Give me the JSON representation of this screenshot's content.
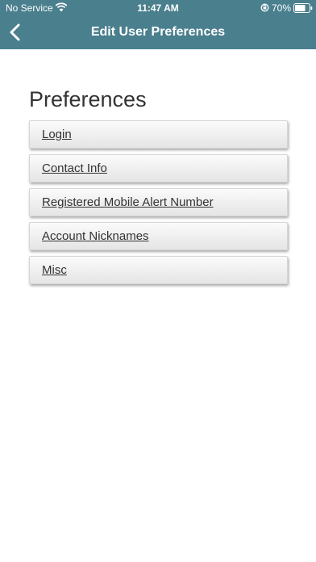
{
  "status_bar": {
    "carrier": "No Service",
    "time": "11:47 AM",
    "battery_percent": "70%",
    "icons": [
      "wifi-icon",
      "orientation-lock-icon",
      "battery-icon"
    ]
  },
  "nav": {
    "title": "Edit User Preferences",
    "back_icon": "chevron-left-icon",
    "bar_color": "#4a7f8e"
  },
  "page": {
    "heading": "Preferences"
  },
  "preferences": [
    {
      "label": "Login"
    },
    {
      "label": "Contact Info"
    },
    {
      "label": "Registered Mobile Alert Number"
    },
    {
      "label": "Account Nicknames"
    },
    {
      "label": "Misc"
    }
  ]
}
